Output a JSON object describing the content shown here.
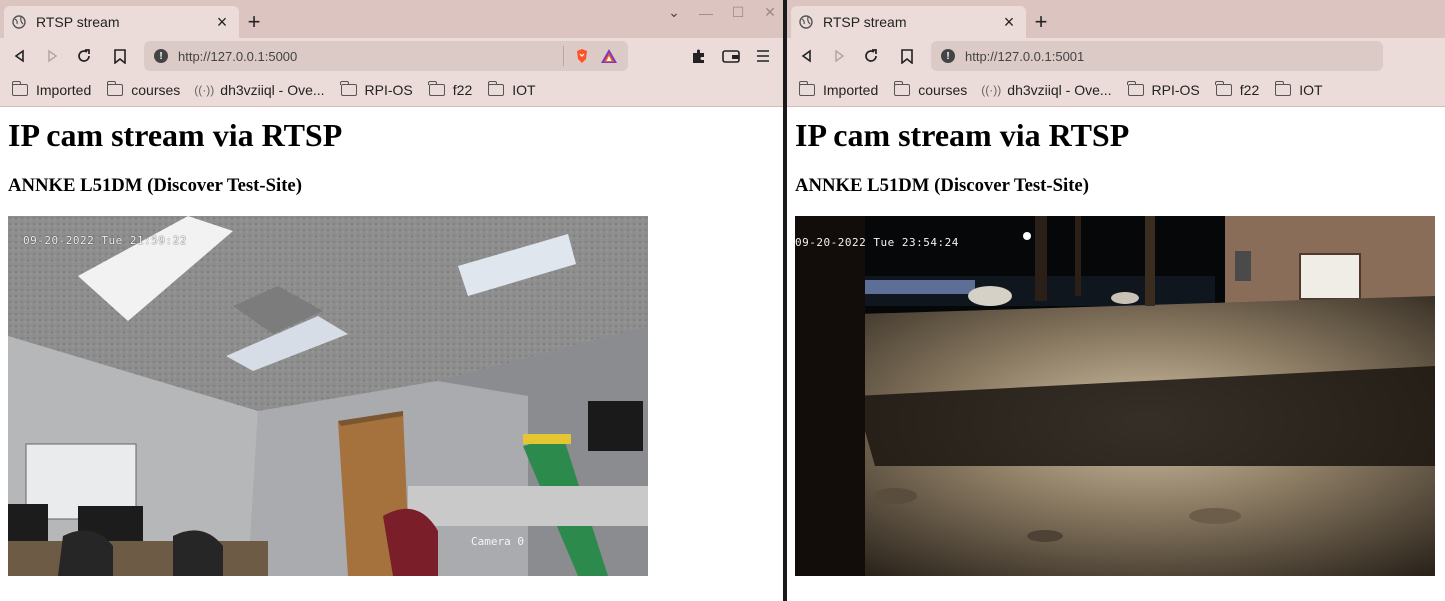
{
  "windows": [
    {
      "tab_title": "RTSP stream",
      "url": "http://127.0.0.1:5000",
      "bookmarks": [
        "Imported",
        "courses",
        "dh3vziiql - Ove...",
        "RPI-OS",
        "f22",
        "IOT"
      ],
      "heading": "IP cam stream via RTSP",
      "subheading": "ANNKE L51DM (Discover Test-Site)",
      "camera_timestamp": "09-20-2022 Tue 21:59:22",
      "camera_label": "Camera 0"
    },
    {
      "tab_title": "RTSP stream",
      "url": "http://127.0.0.1:5001",
      "bookmarks": [
        "Imported",
        "courses",
        "dh3vziiql - Ove...",
        "RPI-OS",
        "f22",
        "IOT"
      ],
      "heading": "IP cam stream via RTSP",
      "subheading": "ANNKE L51DM (Discover Test-Site)",
      "camera_timestamp": "09-20-2022 Tue 23:54:24"
    }
  ],
  "icons": {
    "back": "back-arrow-icon",
    "forward": "forward-arrow-icon",
    "reload": "reload-icon",
    "bookmark": "bookmark-icon",
    "extensions": "puzzle-icon",
    "wallet": "wallet-icon",
    "menu": "hamburger-menu-icon"
  },
  "colors": {
    "chrome_bg": "#ecdcd9",
    "tabstrip_bg": "#dcc5c1",
    "urlbar_bg": "#dccac6",
    "brave_orange": "#fb542b"
  }
}
